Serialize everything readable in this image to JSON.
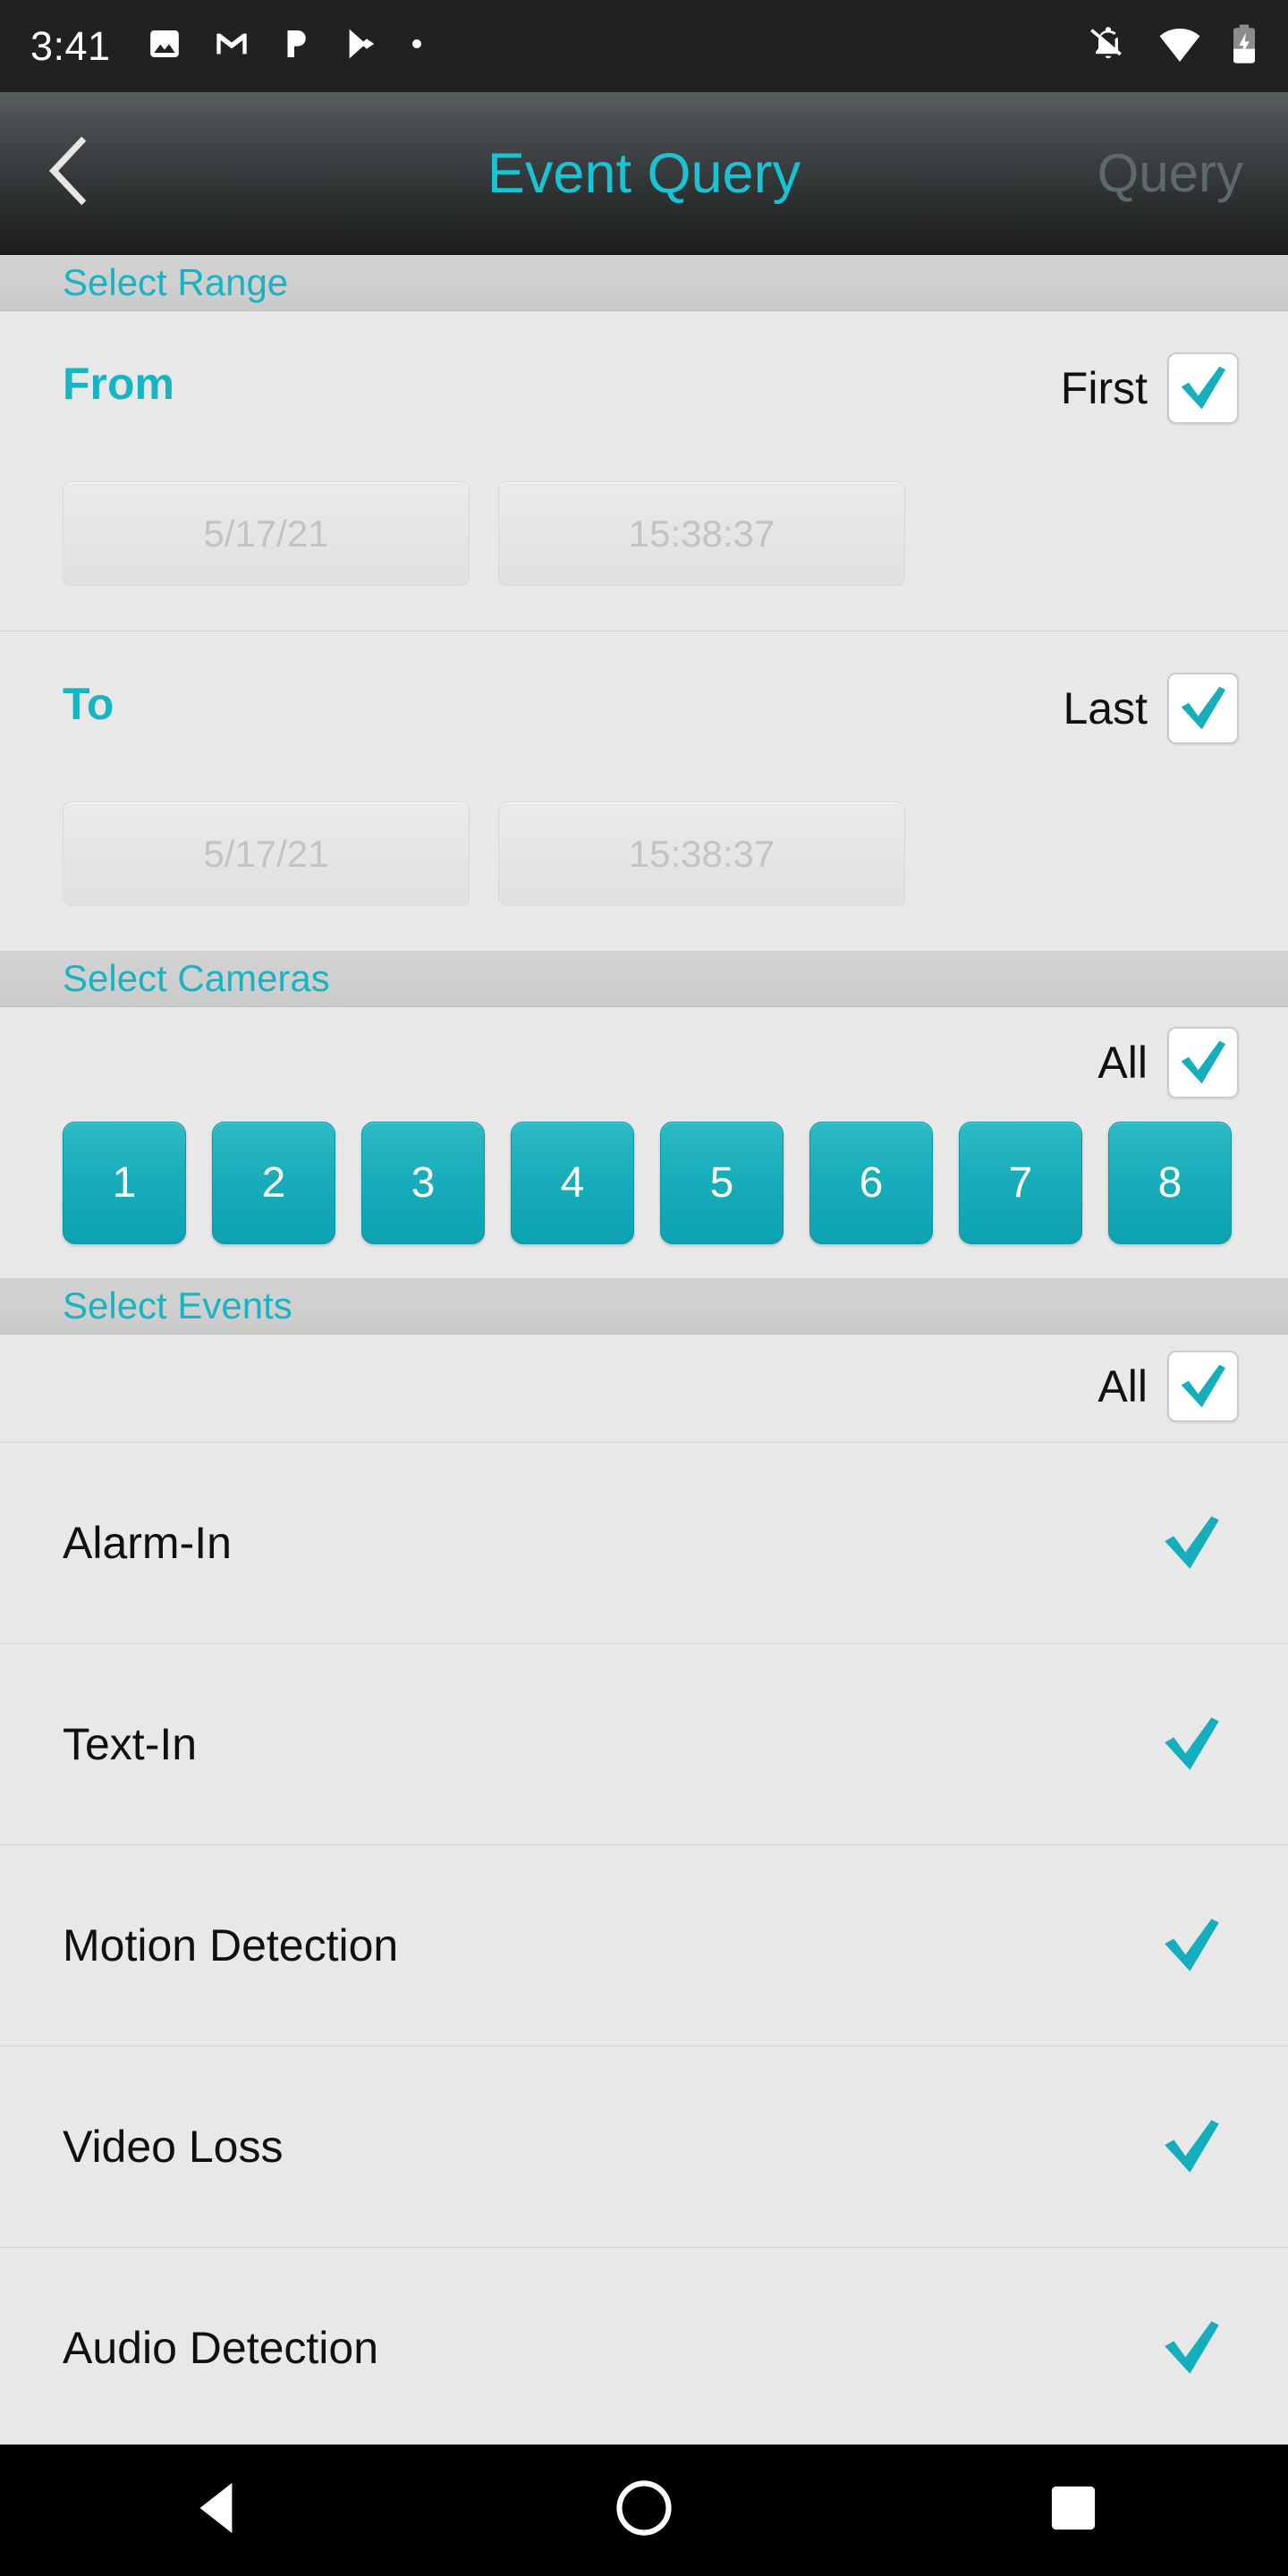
{
  "status_bar": {
    "time": "3:41",
    "left_icons": [
      "image-icon",
      "gmail-icon",
      "pandora-icon",
      "play-store-icon",
      "dot-icon"
    ],
    "right_icons": [
      "notifications-off-icon",
      "wifi-icon",
      "battery-charging-icon"
    ]
  },
  "title_bar": {
    "back_icon": "chevron-left-icon",
    "title": "Event Query",
    "action_label": "Query",
    "title_color": "#18c3d4",
    "action_color": "#5d6a6d"
  },
  "sections": {
    "range": {
      "header": "Select Range",
      "from": {
        "label": "From",
        "checkbox_label": "First",
        "checked": true,
        "date": "5/17/21",
        "time": "15:38:37"
      },
      "to": {
        "label": "To",
        "checkbox_label": "Last",
        "checked": true,
        "date": "5/17/21",
        "time": "15:38:37"
      }
    },
    "cameras": {
      "header": "Select Cameras",
      "all_label": "All",
      "all_checked": true,
      "buttons": [
        "1",
        "2",
        "3",
        "4",
        "5",
        "6",
        "7",
        "8"
      ]
    },
    "events": {
      "header": "Select Events",
      "all_label": "All",
      "all_checked": true,
      "items": [
        {
          "label": "Alarm-In",
          "checked": true
        },
        {
          "label": "Text-In",
          "checked": true
        },
        {
          "label": "Motion Detection",
          "checked": true
        },
        {
          "label": "Video Loss",
          "checked": true
        },
        {
          "label": "Audio Detection",
          "checked": true
        }
      ]
    }
  },
  "nav_bar": {
    "back": "back-triangle-icon",
    "home": "home-circle-icon",
    "recents": "recents-square-icon"
  },
  "colors": {
    "accent_cyan": "#17b5c4",
    "title_cyan": "#18c3d4",
    "camera_button": "#19aebb",
    "panel_bg": "#e8e8e8",
    "section_band": "#cfcfcf"
  }
}
